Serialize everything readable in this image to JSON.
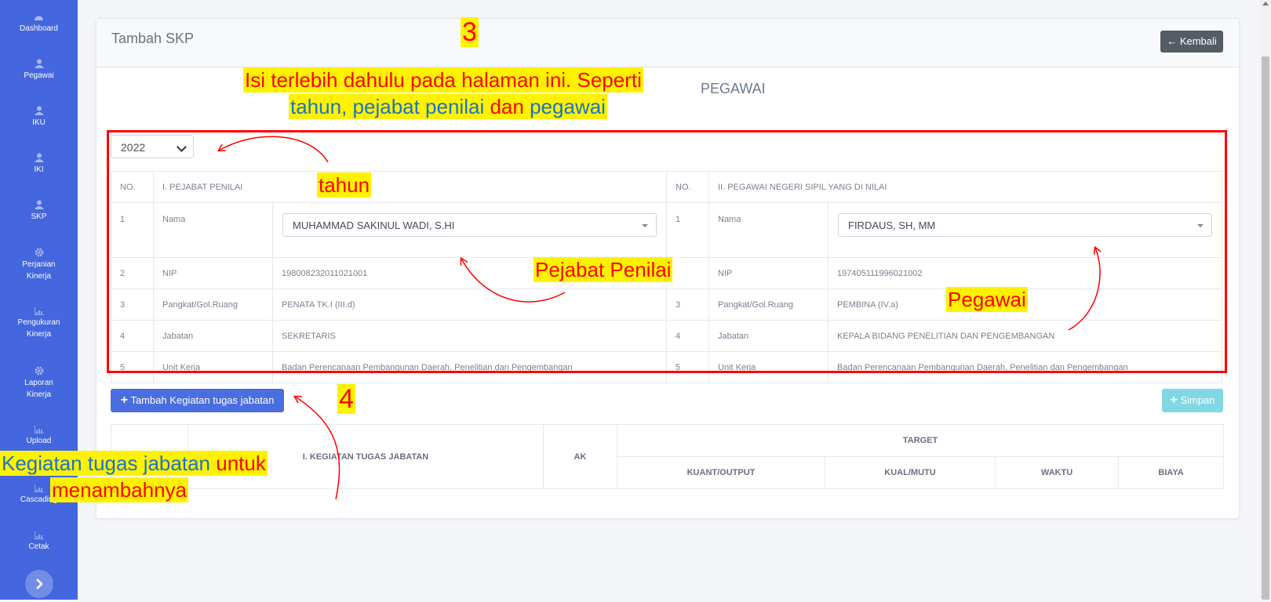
{
  "sidebar": {
    "items": [
      {
        "label": "Dashboard",
        "icon": "dashboard-icon"
      },
      {
        "label": "Pegawai",
        "icon": "user-icon"
      },
      {
        "label": "IKU",
        "icon": "user-icon"
      },
      {
        "label": "IKI",
        "icon": "user-icon"
      },
      {
        "label": "SKP",
        "icon": "user-icon"
      },
      {
        "label": "Perjanian Kinerja",
        "icon": "gear-icon"
      },
      {
        "label": "Pengukuran Kinerja",
        "icon": "chart-icon"
      },
      {
        "label": "Laporan Kinerja",
        "icon": "gear-icon"
      },
      {
        "label": "Upload",
        "icon": "chart-icon"
      },
      {
        "label": "Cascading",
        "icon": "chart-icon"
      },
      {
        "label": "Cetak",
        "icon": "chart-icon"
      }
    ],
    "toggle_icon": "chevron-right-icon"
  },
  "page": {
    "title": "Tambah SKP",
    "back_button": "Kembali",
    "subtitle": "PEGAWAI",
    "year": "2022"
  },
  "info_table": {
    "headers": [
      "NO.",
      "I. PEJABAT PENILAI",
      "NO.",
      "II. PEGAWAI NEGERI SIPIL YANG DI NILAI"
    ],
    "rows": [
      {
        "no": "1",
        "label": "Nama",
        "value": "MUHAMMAD SAKINUL WADI, S.HI",
        "no2": "1",
        "label2": "Nama",
        "value2": "FIRDAUS, SH, MM"
      },
      {
        "no": "2",
        "label": "NIP",
        "value": "198008232011021001",
        "no2": "",
        "label2": "NIP",
        "value2": "197405111996021002"
      },
      {
        "no": "3",
        "label": "Pangkat/Gol.Ruang",
        "value": "PENATA TK.I (III.d)",
        "no2": "3",
        "label2": "Pangkat/Gol.Ruang",
        "value2": "PEMBINA (IV.a)"
      },
      {
        "no": "4",
        "label": "Jabatan",
        "value": "SEKRETARIS",
        "no2": "4",
        "label2": "Jabatan",
        "value2": "KEPALA BIDANG PENELITIAN DAN PENGEMBANGAN"
      },
      {
        "no": "5",
        "label": "Unit Kerja",
        "value": "Badan Perencanaan Pembangunan Daerah, Penelitian dan Pengembangan",
        "no2": "5",
        "label2": "Unit Kerja",
        "value2": "Badan Perencanaan Pembangunan Daerah, Penelitian dan Pengembangan"
      }
    ]
  },
  "actions": {
    "add_label": "Tambah Kegiatan tugas jabatan",
    "save_label": "Simpan"
  },
  "kegiatan_table": {
    "col_kegiatan": "I. KEGIATAN TUGAS JABATAN",
    "col_ak": "AK",
    "target": "TARGET",
    "target_cols": [
      "KUANT/OUTPUT",
      "KUAL/MUTU",
      "WAKTU",
      "BIAYA"
    ]
  },
  "annotations": {
    "step3": "3",
    "step4": "4",
    "instruction_line1": "Isi terlebih dahulu pada halaman ini. Seperti",
    "instruction_w_tahun": "tahun,",
    "instruction_w_pejabat": "pejabat penilai",
    "instruction_w_dan": "dan",
    "instruction_w_pegawai": "pegawai",
    "tahun": "tahun",
    "pejabat_penilai": "Pejabat Penilai",
    "pegawai": "Pegawai",
    "kegiatan_w1": "Kegiatan tugas jabatan",
    "kegiatan_w2": "untuk",
    "kegiatan_w3": "menambahnya"
  },
  "colors": {
    "sidebar": "#4466de",
    "annotation_red": "#ff0000",
    "annotation_blue": "#1a74c4",
    "highlight": "#fff200"
  }
}
